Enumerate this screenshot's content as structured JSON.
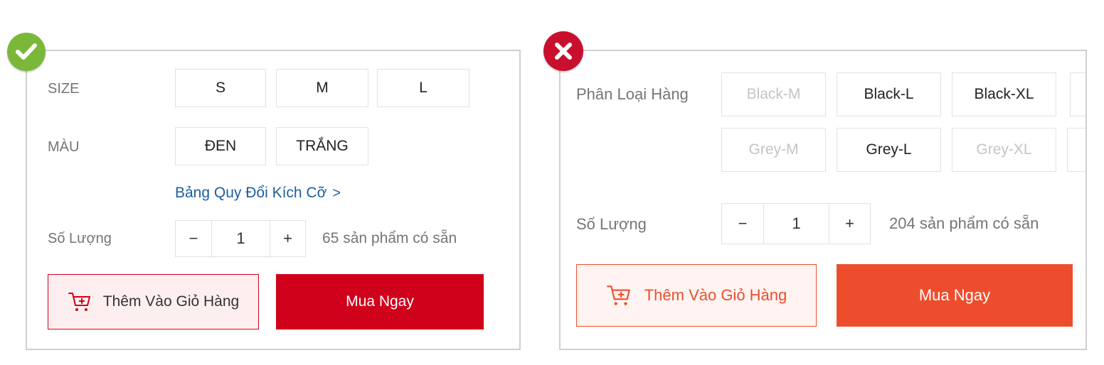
{
  "good_example": {
    "size": {
      "label": "SIZE",
      "options": [
        "S",
        "M",
        "L"
      ]
    },
    "color": {
      "label": "MÀU",
      "options": [
        "ĐEN",
        "TRẮNG"
      ]
    },
    "size_chart_link": "Bảng Quy Đổi Kích Cỡ",
    "quantity": {
      "label": "Số Lượng",
      "minus": "−",
      "value": "1",
      "plus": "+",
      "available": "65 sản phẩm có sẵn"
    },
    "add_to_cart": "Thêm Vào Giỏ Hàng",
    "buy_now": "Mua Ngay",
    "colors": {
      "badge": "#7bb83a",
      "buy_button": "#d0011b",
      "cart_border": "#d0011b",
      "cart_bg": "#fdeff0",
      "link": "#1d5fa0"
    },
    "badge_icon": "check-icon"
  },
  "bad_example": {
    "variation": {
      "label": "Phân Loại Hàng",
      "options": [
        {
          "text": "Black-M",
          "disabled": true
        },
        {
          "text": "Black-L",
          "disabled": false
        },
        {
          "text": "Black-XL",
          "disabled": false
        },
        {
          "text": "Grey-M",
          "disabled": true
        },
        {
          "text": "Grey-L",
          "disabled": false
        },
        {
          "text": "Grey-XL",
          "disabled": true
        }
      ]
    },
    "quantity": {
      "label": "Số Lượng",
      "minus": "−",
      "value": "1",
      "plus": "+",
      "available": "204 sản phẩm có sẵn"
    },
    "add_to_cart": "Thêm Vào Giỏ Hàng",
    "buy_now": "Mua Ngay",
    "colors": {
      "badge": "#c8102e",
      "buy_button": "#ee4d2d",
      "cart_border": "#ee4d2d",
      "cart_bg": "#fff4f1",
      "cart_text": "#ee4d2d"
    },
    "badge_icon": "x-icon"
  }
}
